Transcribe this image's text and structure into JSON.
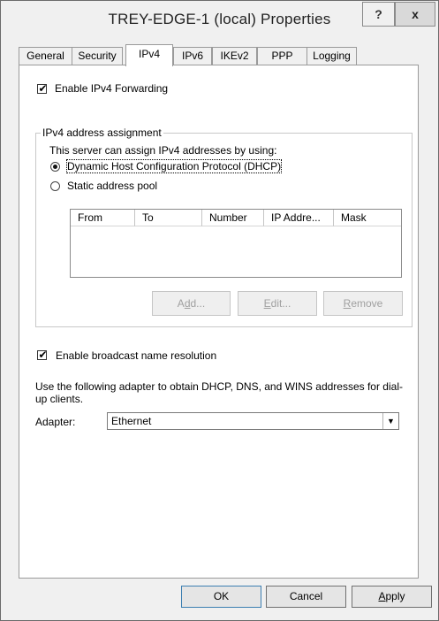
{
  "window": {
    "title": "TREY-EDGE-1 (local) Properties",
    "help_label": "?",
    "close_label": "x"
  },
  "tabs": [
    {
      "label": "General",
      "active": false
    },
    {
      "label": "Security",
      "active": false
    },
    {
      "label": "IPv4",
      "active": true
    },
    {
      "label": "IPv6",
      "active": false
    },
    {
      "label": "IKEv2",
      "active": false
    },
    {
      "label": "PPP",
      "active": false
    },
    {
      "label": "Logging",
      "active": false
    }
  ],
  "ipv4": {
    "enable_forwarding": {
      "label": "Enable IPv4 Forwarding",
      "checked": true
    },
    "assignment_group": {
      "title": "IPv4 address assignment",
      "description": "This server can assign IPv4 addresses by using:",
      "dhcp_option": {
        "label": "Dynamic Host Configuration Protocol (DHCP)",
        "selected": true
      },
      "static_option": {
        "label": "Static address pool",
        "selected": false
      },
      "pool_columns": [
        "From",
        "To",
        "Number",
        "IP Addre...",
        "Mask"
      ],
      "pool_rows": [],
      "add_button": "Add...",
      "edit_button": "Edit...",
      "remove_button": "Remove"
    },
    "broadcast": {
      "label": "Enable broadcast name resolution",
      "checked": true
    },
    "adapter_description": "Use the following adapter to obtain DHCP, DNS, and WINS addresses for dial-up clients.",
    "adapter_label": "Adapter:",
    "adapter_value": "Ethernet"
  },
  "footer": {
    "ok": "OK",
    "cancel": "Cancel",
    "apply": "Apply"
  }
}
